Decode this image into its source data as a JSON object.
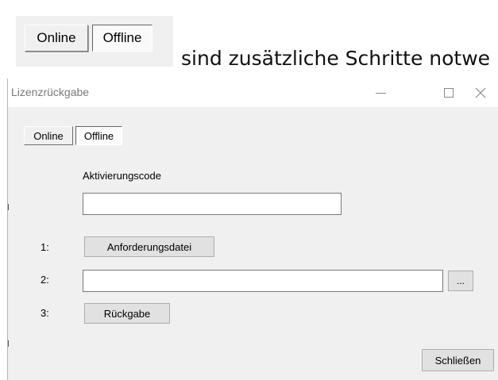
{
  "snippet": {
    "online_label": "Online",
    "offline_label": "Offline",
    "caption": "sind zusätzliche Schritte notwe"
  },
  "dialog": {
    "title": "Lizenzrückgabe",
    "tabs": [
      {
        "label": "Online"
      },
      {
        "label": "Offline"
      }
    ],
    "activation_label": "Aktivierungscode",
    "activation_value": "",
    "steps": [
      {
        "number": "1:",
        "button": "Anforderungsdatei"
      },
      {
        "number": "2:",
        "path_value": "",
        "browse_label": "..."
      },
      {
        "number": "3:",
        "button": "Rückgabe"
      }
    ],
    "close_label": "Schließen"
  },
  "icons": {
    "minimize": "minimize-icon",
    "maximize": "maximize-icon",
    "close": "close-icon"
  }
}
